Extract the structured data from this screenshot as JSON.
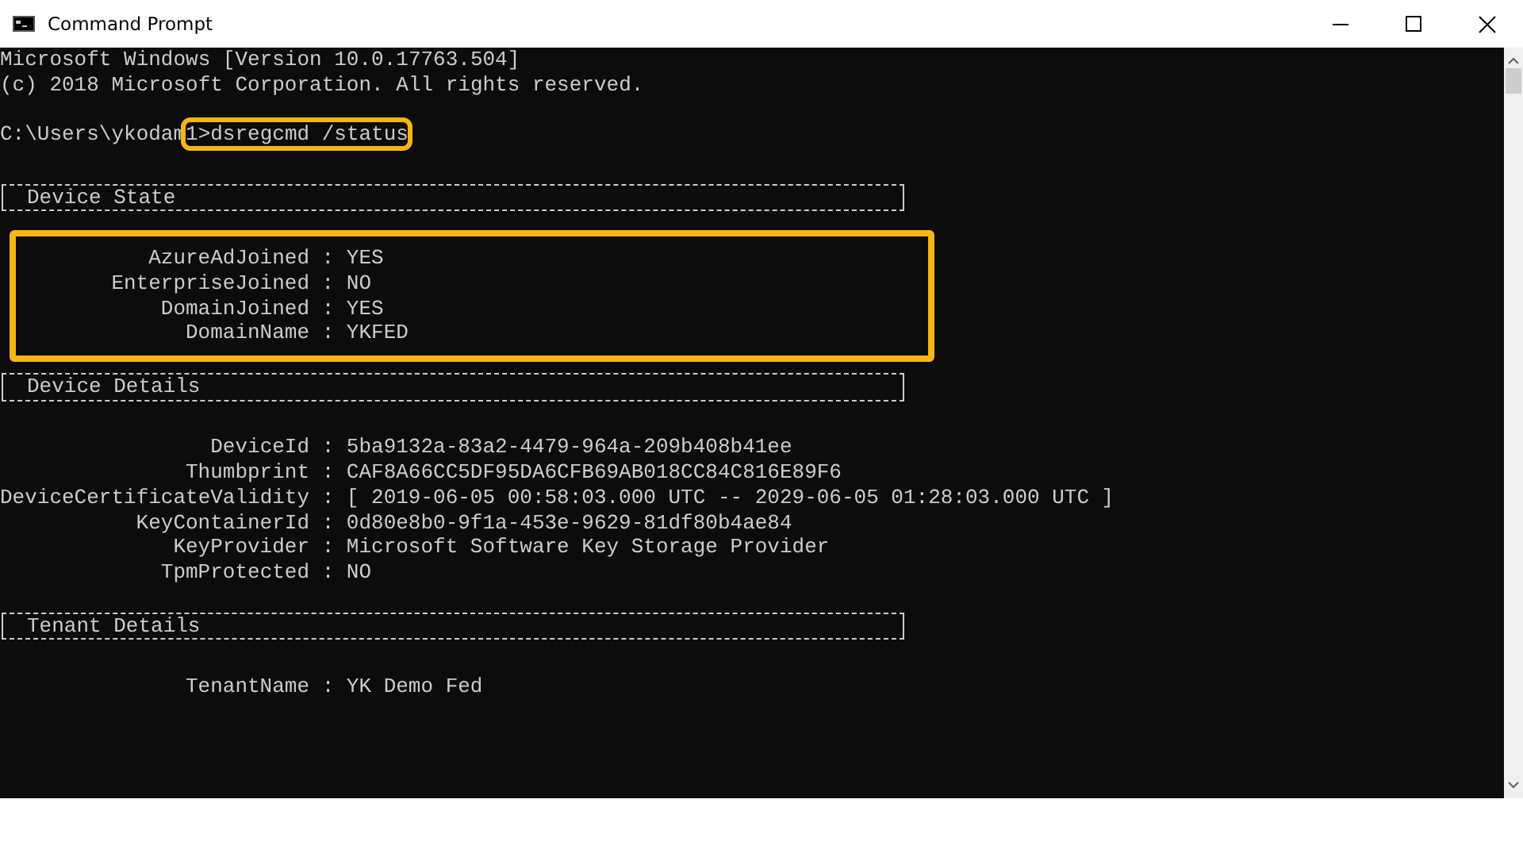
{
  "window": {
    "title": "Command Prompt"
  },
  "header_lines": [
    "Microsoft Windows [Version 10.0.17763.504]",
    "(c) 2018 Microsoft Corporation. All rights reserved."
  ],
  "prompt": {
    "path": "C:\\Users\\ykodam",
    "command": "1>dsregcmd /status",
    "highlighted": true
  },
  "sections": [
    {
      "title": "Device State",
      "highlighted": true,
      "fields": [
        {
          "key": "AzureAdJoined :",
          "value": "YES"
        },
        {
          "key": "EnterpriseJoined :",
          "value": "NO"
        },
        {
          "key": "DomainJoined :",
          "value": "YES"
        },
        {
          "key": "DomainName :",
          "value": "YKFED"
        }
      ]
    },
    {
      "title": "Device Details",
      "highlighted": false,
      "fields": [
        {
          "key": "DeviceId :",
          "value": "5ba9132a-83a2-4479-964a-209b408b41ee"
        },
        {
          "key": "Thumbprint :",
          "value": "CAF8A66CC5DF95DA6CFB69AB018CC84C816E89F6"
        },
        {
          "key": "DeviceCertificateValidity :",
          "value": "[ 2019-06-05 00:58:03.000 UTC -- 2029-06-05 01:28:03.000 UTC ]"
        },
        {
          "key": "KeyContainerId :",
          "value": "0d80e8b0-9f1a-453e-9629-81df80b4ae84"
        },
        {
          "key": "KeyProvider :",
          "value": "Microsoft Software Key Storage Provider"
        },
        {
          "key": "TpmProtected :",
          "value": "NO"
        }
      ]
    },
    {
      "title": "Tenant Details",
      "highlighted": false,
      "fields": [
        {
          "key": "TenantName :",
          "value": "YK Demo Fed"
        }
      ]
    }
  ]
}
